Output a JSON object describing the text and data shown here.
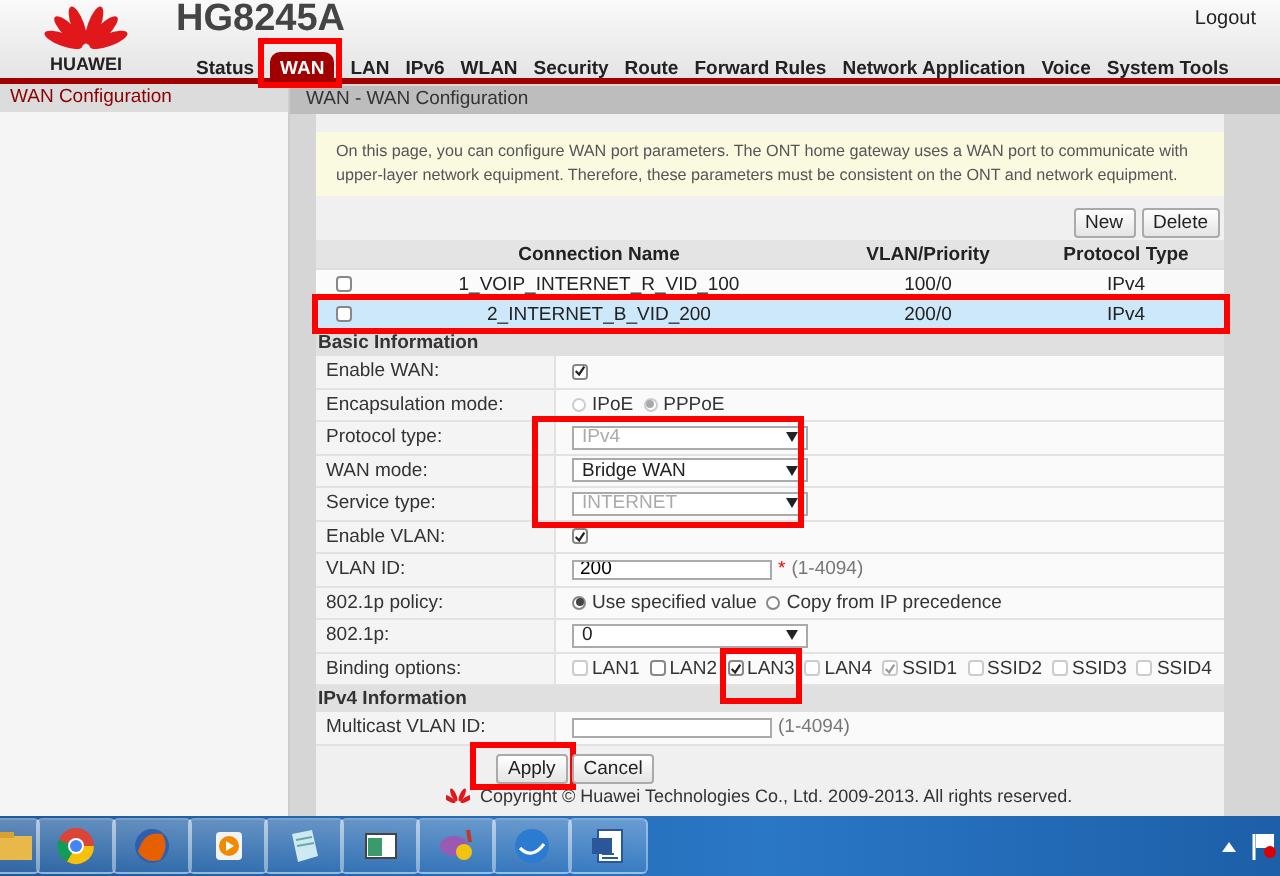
{
  "header": {
    "brand": "HUAWEI",
    "model": "HG8245A",
    "logout": "Logout"
  },
  "nav": [
    {
      "label": "Status",
      "selected": false,
      "highlighted": false
    },
    {
      "label": "WAN",
      "selected": true,
      "highlighted": true
    },
    {
      "label": "LAN",
      "selected": false,
      "highlighted": false
    },
    {
      "label": "IPv6",
      "selected": false,
      "highlighted": false
    },
    {
      "label": "WLAN",
      "selected": false,
      "highlighted": false
    },
    {
      "label": "Security",
      "selected": false,
      "highlighted": false
    },
    {
      "label": "Route",
      "selected": false,
      "highlighted": false
    },
    {
      "label": "Forward Rules",
      "selected": false,
      "highlighted": false
    },
    {
      "label": "Network Application",
      "selected": false,
      "highlighted": false
    },
    {
      "label": "Voice",
      "selected": false,
      "highlighted": false
    },
    {
      "label": "System Tools",
      "selected": false,
      "highlighted": false
    }
  ],
  "sidebar": {
    "title": "WAN Configuration"
  },
  "breadcrumb": "WAN - WAN Configuration",
  "notice": "On this page, you can configure WAN port parameters. The ONT home gateway uses a WAN port to communicate with upper-layer network equipment. Therefore, these parameters must be consistent on the ONT and network equipment.",
  "actions": [
    "New",
    "Delete"
  ],
  "table": {
    "columns": [
      "Connection Name",
      "VLAN/Priority",
      "Protocol Type"
    ],
    "rows": [
      {
        "checked": false,
        "selected": false,
        "highlighted": false,
        "cells": [
          "1_VOIP_INTERNET_R_VID_100",
          "100/0",
          "IPv4"
        ]
      },
      {
        "checked": false,
        "selected": true,
        "highlighted": true,
        "cells": [
          "2_INTERNET_B_VID_200",
          "200/0",
          "IPv4"
        ]
      }
    ]
  },
  "sections": [
    {
      "title": "Basic Information",
      "rows": [
        {
          "kind": "checkbox",
          "label": "Enable WAN:",
          "checked": true
        },
        {
          "kind": "radio",
          "label": "Encapsulation mode:",
          "disabled": true,
          "options": [
            {
              "label": "IPoE",
              "selected": false
            },
            {
              "label": "PPPoE",
              "selected": true
            }
          ]
        },
        {
          "kind": "group",
          "highlighted": true,
          "rows": [
            {
              "kind": "select",
              "label": "Protocol type:",
              "value": "IPv4",
              "disabled": true
            },
            {
              "kind": "select",
              "label": "WAN mode:",
              "value": "Bridge WAN",
              "disabled": false
            },
            {
              "kind": "select",
              "label": "Service type:",
              "value": "INTERNET",
              "disabled": true
            }
          ]
        },
        {
          "kind": "checkbox",
          "label": "Enable VLAN:",
          "checked": true
        },
        {
          "kind": "text",
          "label": "VLAN ID:",
          "value": "200",
          "required_mark": "*",
          "hint": "(1-4094)"
        },
        {
          "kind": "radio",
          "label": "802.1p policy:",
          "disabled": false,
          "options": [
            {
              "label": "Use specified value",
              "selected": true
            },
            {
              "label": "Copy from IP precedence",
              "selected": false
            }
          ]
        },
        {
          "kind": "select",
          "label": "802.1p:",
          "value": "0",
          "disabled": false
        },
        {
          "kind": "options",
          "label": "Binding options:",
          "options": [
            {
              "label": "LAN1",
              "checked": false,
              "disabled": true,
              "highlighted": false
            },
            {
              "label": "LAN2",
              "checked": false,
              "disabled": false,
              "highlighted": false
            },
            {
              "label": "LAN3",
              "checked": true,
              "disabled": false,
              "highlighted": true
            },
            {
              "label": "LAN4",
              "checked": false,
              "disabled": true,
              "highlighted": false
            },
            {
              "label": "SSID1",
              "checked": true,
              "disabled": true,
              "highlighted": false
            },
            {
              "label": "SSID2",
              "checked": false,
              "disabled": true,
              "highlighted": false
            },
            {
              "label": "SSID3",
              "checked": false,
              "disabled": true,
              "highlighted": false
            },
            {
              "label": "SSID4",
              "checked": false,
              "disabled": true,
              "highlighted": false
            }
          ]
        }
      ]
    },
    {
      "title": "IPv4 Information",
      "rows": [
        {
          "kind": "text",
          "label": "Multicast VLAN ID:",
          "hint": "(1-4094)"
        }
      ]
    }
  ],
  "buttons": [
    {
      "label": "Apply",
      "highlighted": true
    },
    {
      "label": "Cancel",
      "highlighted": false
    }
  ],
  "copyright": "Copyright © Huawei Technologies Co., Ltd. 2009-2013. All rights reserved."
}
